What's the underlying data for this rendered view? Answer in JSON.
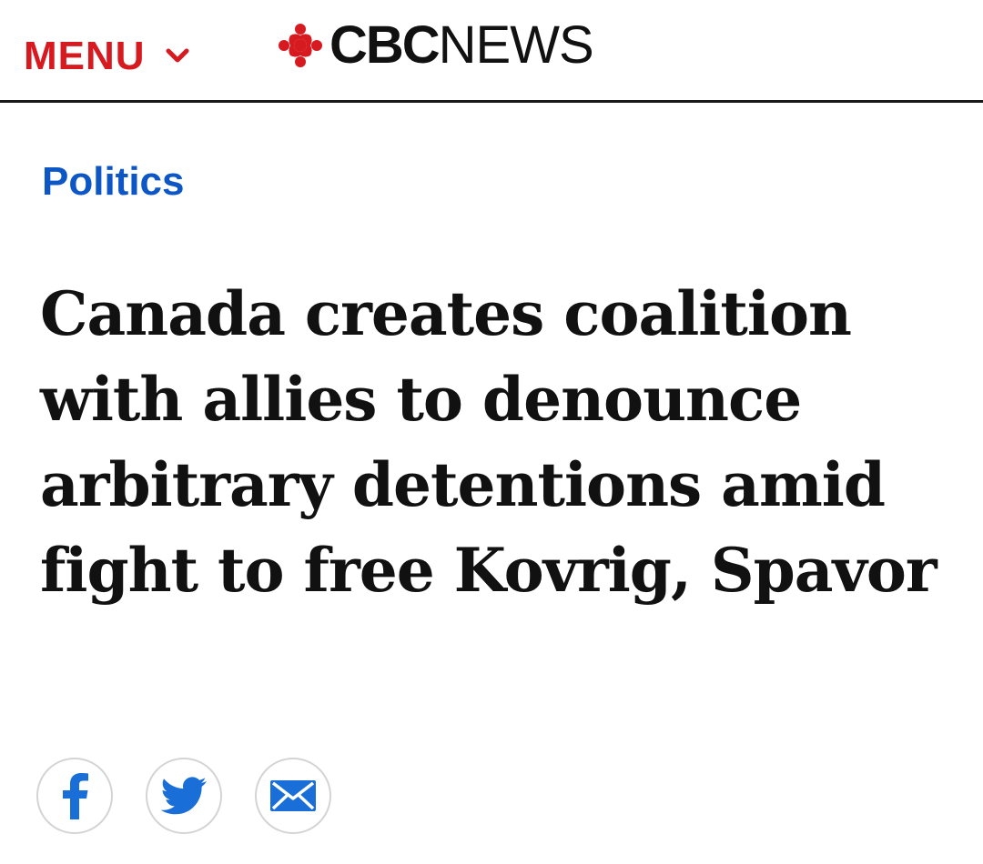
{
  "header": {
    "menu_label": "MENU",
    "menu_icon": "chevron-down-icon",
    "logo_cbc": "CBC",
    "logo_news": "NEWS",
    "logo_icon": "cbc-gem-icon"
  },
  "article": {
    "section": "Politics",
    "headline": "Canada creates coalition with allies to denounce arbitrary detentions amid fight to free Kovrig, Spavor"
  },
  "share": [
    {
      "icon": "facebook-icon"
    },
    {
      "icon": "twitter-icon"
    },
    {
      "icon": "email-icon"
    }
  ],
  "colors": {
    "brand_red": "#d71920",
    "link_blue": "#0d56c5",
    "share_blue": "#1a6ed8",
    "text": "#111111"
  }
}
